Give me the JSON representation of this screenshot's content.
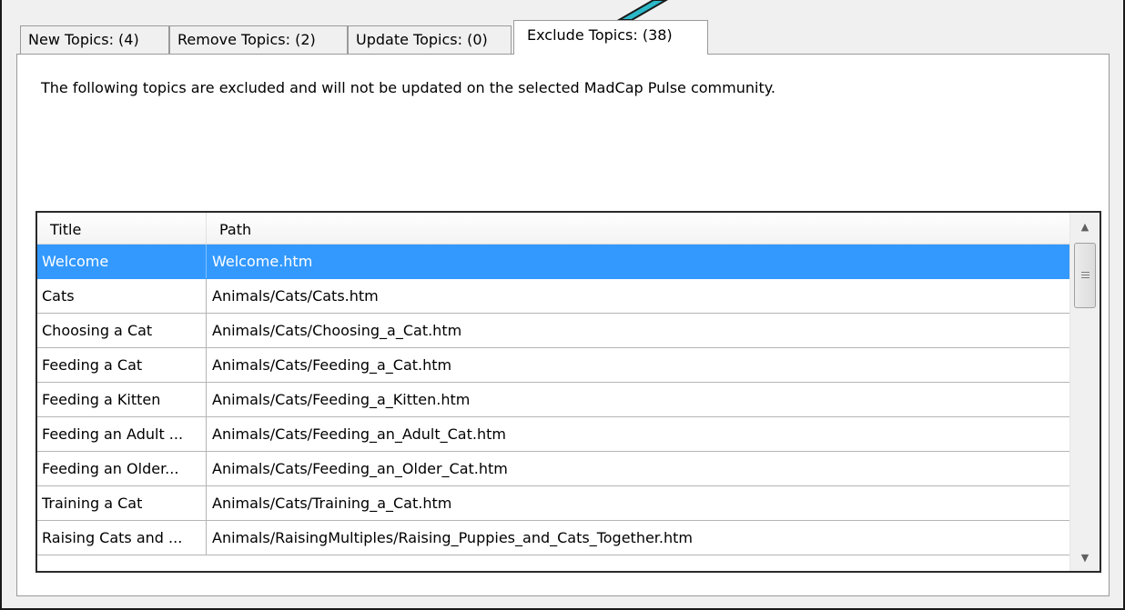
{
  "tabs": [
    {
      "label": "New Topics: (4)",
      "active": false
    },
    {
      "label": "Remove Topics: (2)",
      "active": false
    },
    {
      "label": "Update Topics: (0)",
      "active": false
    },
    {
      "label": "Exclude Topics: (38)",
      "active": true
    }
  ],
  "panel": {
    "description": "The following topics are excluded and will not be updated on the selected MadCap Pulse community."
  },
  "table": {
    "columns": [
      "Title",
      "Path"
    ],
    "rows": [
      {
        "title": "Welcome",
        "path": "Welcome.htm",
        "selected": true
      },
      {
        "title": "Cats",
        "path": "Animals/Cats/Cats.htm"
      },
      {
        "title": "Choosing a Cat",
        "path": "Animals/Cats/Choosing_a_Cat.htm"
      },
      {
        "title": "Feeding a Cat",
        "path": "Animals/Cats/Feeding_a_Cat.htm"
      },
      {
        "title": "Feeding a Kitten",
        "path": "Animals/Cats/Feeding_a_Kitten.htm"
      },
      {
        "title": "Feeding an Adult ...",
        "path": "Animals/Cats/Feeding_an_Adult_Cat.htm"
      },
      {
        "title": "Feeding an Older...",
        "path": "Animals/Cats/Feeding_an_Older_Cat.htm"
      },
      {
        "title": "Training a Cat",
        "path": "Animals/Cats/Training_a_Cat.htm"
      },
      {
        "title": "Raising Cats and ...",
        "path": "Animals/RaisingMultiples/Raising_Puppies_and_Cats_Together.htm"
      }
    ]
  },
  "colors": {
    "selection": "#3399ff",
    "callout": "#2bb8c9"
  },
  "icons": {
    "scroll_up": "scroll-up-arrow",
    "scroll_down": "scroll-down-arrow",
    "callout": "callout-pointer"
  }
}
